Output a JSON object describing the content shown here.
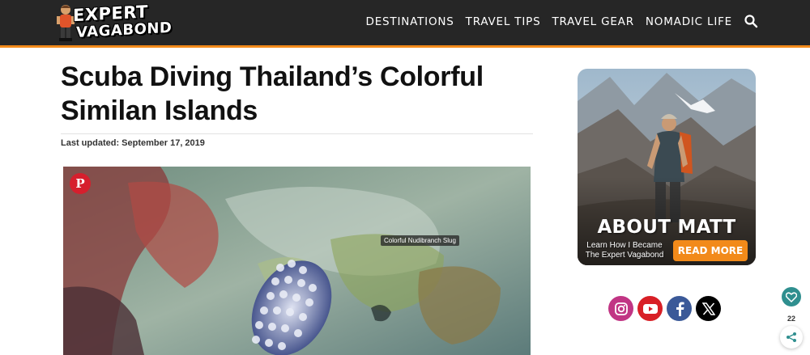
{
  "header": {
    "logo": {
      "line1": "EXPERT",
      "line2": "VAGABOND"
    },
    "nav": [
      {
        "label": "DESTINATIONS"
      },
      {
        "label": "TRAVEL TIPS"
      },
      {
        "label": "TRAVEL GEAR"
      },
      {
        "label": "NOMADIC LIFE"
      }
    ],
    "search_icon": "search-icon"
  },
  "article": {
    "title": "Scuba Diving Thailand’s Colorful Similan Islands",
    "updated": "Last updated: September 17, 2019",
    "hero": {
      "caption": "Colorful Nudibranch Slug",
      "pin_icon": "pinterest-icon"
    }
  },
  "sidebar": {
    "about": {
      "title": "ABOUT MATT",
      "subtitle": "Learn How I Became The Expert Vagabond",
      "button": "READ MORE"
    },
    "social": [
      {
        "icon": "instagram-icon",
        "color": "#c13584"
      },
      {
        "icon": "youtube-icon",
        "color": "#d81f26"
      },
      {
        "icon": "facebook-icon",
        "color": "#3b5998"
      },
      {
        "icon": "x-icon",
        "color": "#000000"
      }
    ]
  },
  "share_rail": {
    "count": "22"
  },
  "colors": {
    "accent": "#f28a1a",
    "header_bg": "#262626"
  }
}
